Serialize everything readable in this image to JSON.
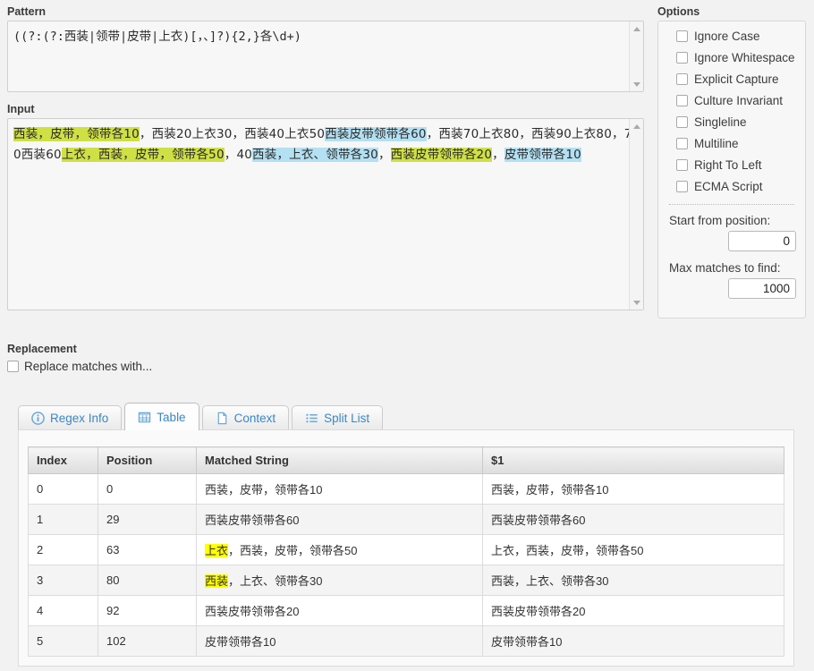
{
  "pattern": {
    "label": "Pattern",
    "value": "((?:(?:西装|领带|皮带|上衣)[，、]?){2,}各\\d+)"
  },
  "input": {
    "label": "Input",
    "segments": [
      {
        "text": "西装，皮带，领带各10",
        "hl": "green"
      },
      {
        "text": "，西装20上衣30，西装40上衣50",
        "hl": "none"
      },
      {
        "text": "西装皮带领带各60",
        "hl": "blue"
      },
      {
        "text": "，西装70上衣80，西装90上衣80，70西装60",
        "hl": "none"
      },
      {
        "text": "上衣，西装，皮带，领带各50",
        "hl": "green"
      },
      {
        "text": "，40",
        "hl": "none"
      },
      {
        "text": "西装，上衣、领带各30",
        "hl": "blue"
      },
      {
        "text": "，",
        "hl": "none"
      },
      {
        "text": "西装皮带领带各20",
        "hl": "green"
      },
      {
        "text": "，",
        "hl": "none"
      },
      {
        "text": "皮带领带各10",
        "hl": "blue"
      }
    ]
  },
  "options": {
    "label": "Options",
    "checkboxes": [
      {
        "label": "Ignore Case",
        "checked": false
      },
      {
        "label": "Ignore Whitespace",
        "checked": false
      },
      {
        "label": "Explicit Capture",
        "checked": false
      },
      {
        "label": "Culture Invariant",
        "checked": false
      },
      {
        "label": "Singleline",
        "checked": false
      },
      {
        "label": "Multiline",
        "checked": false
      },
      {
        "label": "Right To Left",
        "checked": false
      },
      {
        "label": "ECMA Script",
        "checked": false
      }
    ],
    "start_position_label": "Start from position:",
    "start_position_value": "0",
    "max_matches_label": "Max matches to find:",
    "max_matches_value": "1000"
  },
  "replacement": {
    "label": "Replacement",
    "checkbox_label": "Replace matches with...",
    "checked": false
  },
  "tabs": [
    {
      "label": "Regex Info",
      "icon": "info-icon",
      "active": false
    },
    {
      "label": "Table",
      "icon": "table-icon",
      "active": true
    },
    {
      "label": "Context",
      "icon": "document-icon",
      "active": false
    },
    {
      "label": "Split List",
      "icon": "list-icon",
      "active": false
    }
  ],
  "results_table": {
    "columns": [
      "Index",
      "Position",
      "Matched String",
      "$1"
    ],
    "rows": [
      {
        "index": "0",
        "position": "0",
        "matched_hl": "",
        "matched_rest": "西装，皮带，领带各10",
        "group1": "西装，皮带，领带各10"
      },
      {
        "index": "1",
        "position": "29",
        "matched_hl": "",
        "matched_rest": "西装皮带领带各60",
        "group1": "西装皮带领带各60"
      },
      {
        "index": "2",
        "position": "63",
        "matched_hl": "上衣",
        "matched_rest": "，西装，皮带，领带各50",
        "group1": "上衣，西装，皮带，领带各50"
      },
      {
        "index": "3",
        "position": "80",
        "matched_hl": "西装",
        "matched_rest": "，上衣、领带各30",
        "group1": "西装，上衣、领带各30"
      },
      {
        "index": "4",
        "position": "92",
        "matched_hl": "",
        "matched_rest": "西装皮带领带各20",
        "group1": "西装皮带领带各20"
      },
      {
        "index": "5",
        "position": "102",
        "matched_hl": "",
        "matched_rest": "皮带领带各10",
        "group1": "皮带领带各10"
      }
    ]
  },
  "colors": {
    "highlight_green": "#cfe045",
    "highlight_blue": "#b3e0f2",
    "highlight_yellow": "#ffff00",
    "tab_text": "#3b87c4"
  }
}
